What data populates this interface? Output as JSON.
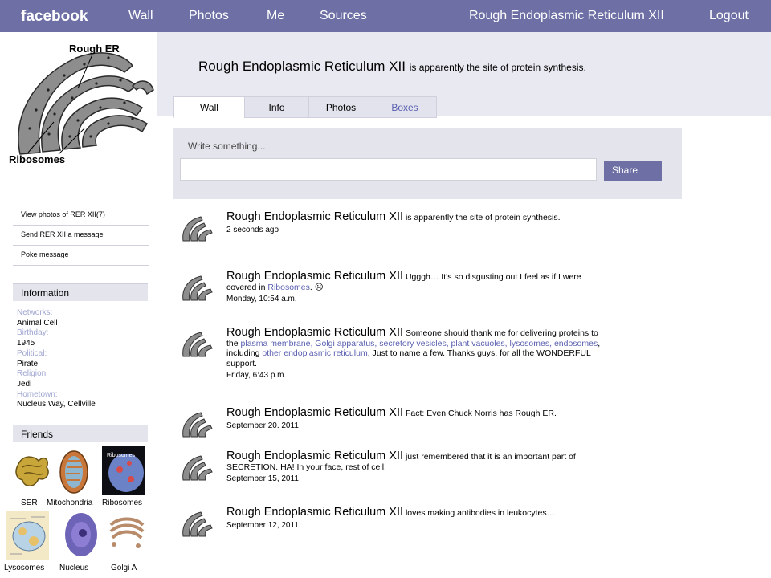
{
  "topbar": {
    "logo": "facebook",
    "nav": [
      "Wall",
      "Photos",
      "Me",
      "Sources"
    ],
    "profile_name": "Rough Endoplasmic Reticulum XII",
    "logout": "Logout"
  },
  "profile": {
    "picture_labels": {
      "top": "Rough ER",
      "bottom": "Ribosomes"
    },
    "headline_name": "Rough Endoplasmic Reticulum XII",
    "headline_status": "is apparently the site of protein synthesis."
  },
  "tabs": [
    "Wall",
    "Info",
    "Photos",
    "Boxes"
  ],
  "side_links": [
    "View photos of RER XII(7)",
    "Send RER XII a message",
    "Poke message"
  ],
  "information": {
    "heading": "Information",
    "fields": [
      {
        "label": "Networks:",
        "value": "Animal Cell"
      },
      {
        "label": "Birthday:",
        "value": "1945"
      },
      {
        "label": "Political:",
        "value": "Pirate"
      },
      {
        "label": "Religion:",
        "value": "Jedi"
      },
      {
        "label": "Hometown:",
        "value": "Nucleus Way, Cellville"
      }
    ]
  },
  "friends": {
    "heading": "Friends",
    "items": [
      "SER",
      "Mitochondria",
      "Ribosomes",
      "Lysosomes",
      "Nucleus",
      "Golgi A"
    ]
  },
  "composer": {
    "prompt": "Write something...",
    "share": "Share"
  },
  "posts": [
    {
      "name": "Rough Endoplasmic Reticulum XII",
      "segments": [
        {
          "t": " is apparently the site of protein synthesis."
        }
      ],
      "time": "2 seconds ago"
    },
    {
      "name": "Rough Endoplasmic Reticulum XII",
      "segments": [
        {
          "t": " Ugggh… It’s so disgusting out I feel as if I were covered in "
        },
        {
          "t": "Ribosomes",
          "link": true
        },
        {
          "t": ". ☹"
        }
      ],
      "time": "Monday, 10:54 a.m."
    },
    {
      "name": "Rough Endoplasmic Reticulum XII",
      "segments": [
        {
          "t": " Someone should thank me for delivering proteins to the "
        },
        {
          "t": "plasma membrane, Golgi apparatus, secretory vesicles, plant vacuoles, lysosomes, endosomes",
          "link": true
        },
        {
          "t": ", including "
        },
        {
          "t": "other endoplasmic reticulum",
          "link": true
        },
        {
          "t": ", Just to name a few. Thanks guys, for all the WONDERFUL support."
        }
      ],
      "time": "Friday, 6:43 p.m."
    },
    {
      "name": "Rough Endoplasmic Reticulum XII",
      "segments": [
        {
          "t": " Fact: Even Chuck Norris has Rough ER."
        }
      ],
      "time": "September 20. 2011"
    },
    {
      "name": "Rough Endoplasmic Reticulum XII",
      "segments": [
        {
          "t": " just remembered that it is an important part of SECRETION.  HA! In your face, rest of cell!"
        }
      ],
      "time": "September 15, 2011"
    },
    {
      "name": "Rough Endoplasmic Reticulum XII",
      "segments": [
        {
          "t": " loves making antibodies in leukocytes…"
        }
      ],
      "time": "September 12, 2011"
    }
  ]
}
